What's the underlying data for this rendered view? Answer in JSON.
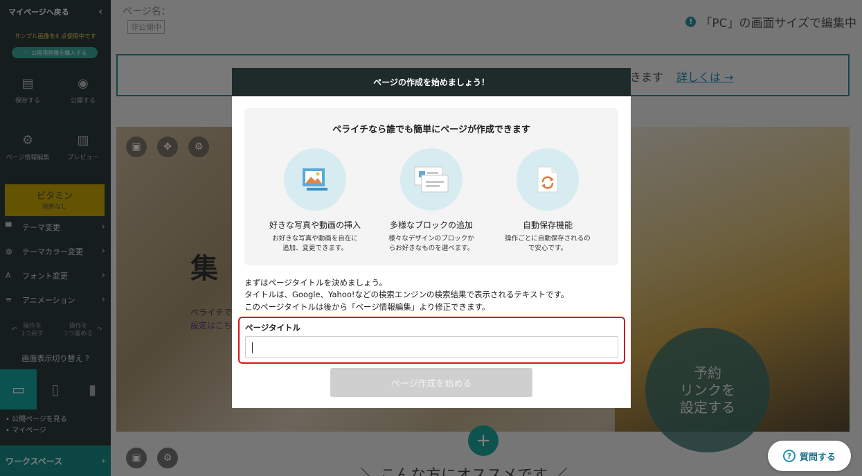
{
  "sidebar": {
    "back_label": "マイページへ戻る",
    "sample_note": "サンプル画像を4 点使用中です",
    "buy_label": "🛒 公開用画像を購入する",
    "save_label": "保存する",
    "publish_label": "公開する",
    "page_info_label": "ページ情報編集",
    "preview_label": "プレビュー",
    "theme_name": "ビタミン",
    "theme_sub": "装飾なし",
    "menu": [
      {
        "label": "テーマ変更"
      },
      {
        "label": "テーマカラー変更"
      },
      {
        "label": "フォント変更"
      },
      {
        "label": "アニメーション"
      }
    ],
    "undo_label": "操作を\n1つ戻す",
    "redo_label": "操作を\n1つ進める",
    "screen_switch_label": "画面表示切り替え",
    "link_public": "• 公開ページを見る",
    "link_mypage": "• マイページ",
    "workspace_label": "ワークスペース"
  },
  "editor": {
    "page_name_label": "ページ名：",
    "status_badge": "非公開中",
    "screen_note": "「PC」の画面サイズで編集中",
    "notice_text": "きます",
    "notice_link": "詳しくは →",
    "hero_title": "集",
    "hero_sub_1": "ペライチで",
    "hero_sub_2": "設定はこち",
    "reserve_label": "予約\nリンクを\n設定する",
    "recommend_text": "＼ こんな方にオススメです ／",
    "help_label": "質問する"
  },
  "modal": {
    "header": "ページの作成を始めましょう！",
    "info_heading": "ペライチなら誰でも簡単にページが作成できます",
    "features": [
      {
        "title": "好きな写真や動画の挿入",
        "desc_1": "お好きな写真や動画を自在に",
        "desc_2": "追加、変更できます。"
      },
      {
        "title": "多様なブロックの追加",
        "desc_1": "様々なデザインのブロックか",
        "desc_2": "らお好きなものを選べます。"
      },
      {
        "title": "自動保存機能",
        "desc_1": "操作ごとに自動保存されるの",
        "desc_2": "で安心です。"
      }
    ],
    "intro_1": "まずはページタイトルを決めましょう。",
    "intro_2": "タイトルは、Google、Yahoo!などの検索エンジンの検索結果で表示されるテキストです。",
    "intro_3": "このページタイトルは後から「ページ情報編集」より修正できます。",
    "title_label": "ページタイトル",
    "title_value": "",
    "start_button": "ページ作成を始める"
  },
  "colors": {
    "sidebar_bg": "#2d3a3a",
    "accent_teal": "#14a6a1",
    "highlight_red": "#d0191b",
    "disabled_button": "#cfcfcf"
  }
}
